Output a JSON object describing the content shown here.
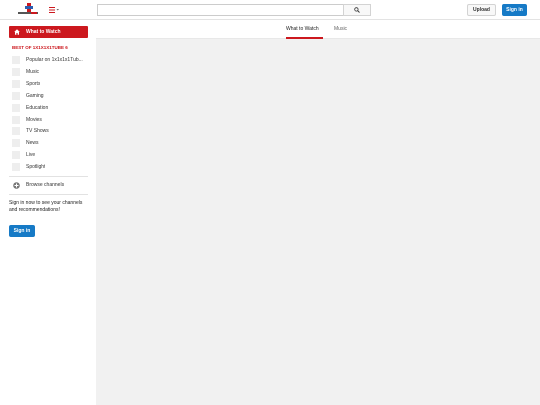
{
  "header": {
    "search_placeholder": "",
    "upload_label": "Upload",
    "signin_label": "Sign in"
  },
  "sidebar": {
    "what_to_watch": "What to Watch",
    "best_of_title": "BEST OF 1X1X1X1TUBE 6",
    "channels": [
      "Popular on 1x1x1x1Tub...",
      "Music",
      "Sports",
      "Gaming",
      "Education",
      "Movies",
      "TV Shows",
      "News",
      "Live",
      "Spotlight"
    ],
    "browse_channels": "Browse channels",
    "signin_prompt": "Sign in now to see your channels and recommendations!",
    "signin_label": "Sign in"
  },
  "main": {
    "tabs": [
      {
        "label": "What to Watch",
        "active": true
      },
      {
        "label": "Music",
        "active": false
      }
    ]
  },
  "colors": {
    "accent_red": "#cc181e",
    "accent_blue": "#167ac6",
    "content_bg": "#f1f1f1"
  },
  "icons": {
    "logo": "site-logo",
    "guide": "hamburger-menu-icon",
    "search": "magnifier-icon",
    "home": "home-icon",
    "browse": "plus-circle-icon"
  }
}
